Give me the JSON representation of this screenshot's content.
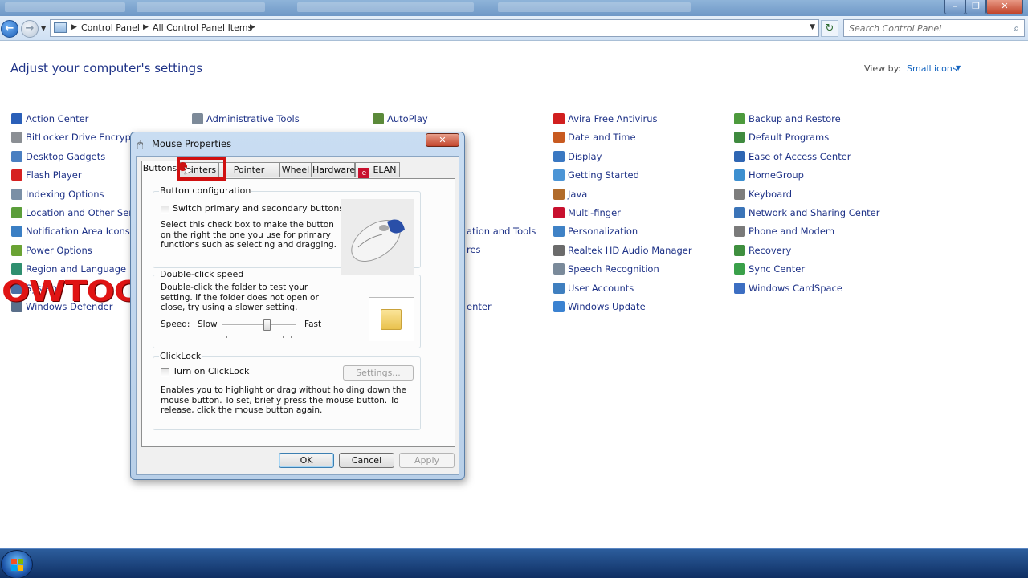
{
  "window": {
    "minimize_icon": "minimize-icon",
    "maximize_icon": "maximize-icon",
    "close_icon": "close-icon"
  },
  "address": {
    "breadcrumbs": [
      "Control Panel",
      "All Control Panel Items"
    ],
    "search_placeholder": "Search Control Panel"
  },
  "main": {
    "title": "Adjust your computer's settings",
    "view_by_label": "View by:",
    "view_by_value": "Small icons"
  },
  "columns": [
    {
      "items": [
        {
          "label": "Action Center",
          "color": "#2a5fb8"
        },
        {
          "label": "BitLocker Drive Encryption",
          "color": "#8b8f94"
        },
        {
          "label": "Desktop Gadgets",
          "color": "#4a7fc1"
        },
        {
          "label": "Flash Player",
          "color": "#d62020"
        },
        {
          "label": "Indexing Options",
          "color": "#7a8fa6"
        },
        {
          "label": "Location and Other Sensors",
          "color": "#5b9e3a"
        },
        {
          "label": "Notification Area Icons",
          "color": "#3b7fc4"
        },
        {
          "label": "Power Options",
          "color": "#6aa334"
        },
        {
          "label": "Region and Language",
          "color": "#2f8f6f"
        },
        {
          "label": "System",
          "color": "#4a6fa5"
        },
        {
          "label": "Windows Defender",
          "color": "#5a6f8a"
        }
      ]
    },
    {
      "items": [
        {
          "label": "Administrative Tools",
          "color": "#7d8a99"
        }
      ]
    },
    {
      "items": [
        {
          "label": "AutoPlay",
          "color": "#5b8a3a"
        }
      ]
    },
    {
      "items": [
        {
          "label": "Avira Free Antivirus",
          "color": "#d11f1f"
        },
        {
          "label": "Date and Time",
          "color": "#c85a20"
        },
        {
          "label": "Display",
          "color": "#3a78c2"
        },
        {
          "label": "Getting Started",
          "color": "#4c95d6"
        },
        {
          "label": "Java",
          "color": "#b06a2a"
        },
        {
          "label": "Multi-finger",
          "color": "#c8102e"
        },
        {
          "label": "Personalization",
          "color": "#3f82c6"
        },
        {
          "label": "Realtek HD Audio Manager",
          "color": "#6b6b6b"
        },
        {
          "label": "Speech Recognition",
          "color": "#7a8a9a"
        },
        {
          "label": "User Accounts",
          "color": "#3f7fbf"
        },
        {
          "label": "Windows Update",
          "color": "#3b82d1"
        }
      ]
    },
    {
      "items": [
        {
          "label": "Backup and Restore",
          "color": "#4d9a3d"
        },
        {
          "label": "Default Programs",
          "color": "#3f8a3f"
        },
        {
          "label": "Ease of Access Center",
          "color": "#2f66b3"
        },
        {
          "label": "HomeGroup",
          "color": "#3d8fd0"
        },
        {
          "label": "Keyboard",
          "color": "#7d7d7d"
        },
        {
          "label": "Network and Sharing Center",
          "color": "#3b74b8"
        },
        {
          "label": "Phone and Modem",
          "color": "#7a7a7a"
        },
        {
          "label": "Recovery",
          "color": "#3f8f3f"
        },
        {
          "label": "Sync Center",
          "color": "#3aa04a"
        },
        {
          "label": "Windows CardSpace",
          "color": "#3c6ec2"
        }
      ]
    }
  ],
  "partial_labels": [
    "ation and Tools",
    "res",
    "enter"
  ],
  "watermark": "OWTOCREATOR",
  "dialog": {
    "title": "Mouse Properties",
    "close_icon": "close-icon",
    "tabs": [
      {
        "label": "Buttons",
        "active": true
      },
      {
        "label": "Pointers",
        "active": false
      },
      {
        "label": "Pointer Options",
        "active": false
      },
      {
        "label": "Wheel",
        "active": false
      },
      {
        "label": "Hardware",
        "active": false
      },
      {
        "label": "ELAN",
        "active": false
      }
    ],
    "button_config": {
      "title": "Button configuration",
      "checkbox_label": "Switch primary and secondary buttons",
      "checked": false,
      "description": "Select this check box to make the button on the right the one you use for primary functions such as selecting and dragging."
    },
    "double_click": {
      "title": "Double-click speed",
      "description": "Double-click the folder to test your setting. If the folder does not open or close, try using a slower setting.",
      "speed_label": "Speed:",
      "slow_label": "Slow",
      "fast_label": "Fast",
      "speed_level": 0.6
    },
    "clicklock": {
      "title": "ClickLock",
      "checkbox_label": "Turn on ClickLock",
      "checked": false,
      "settings_button": "Settings...",
      "description": "Enables you to highlight or drag without holding down the mouse button. To set, briefly press the mouse button. To release, click the mouse button again."
    },
    "buttons": {
      "ok": "OK",
      "cancel": "Cancel",
      "apply": "Apply"
    }
  },
  "taskbar": {
    "start_icon": "windows-logo-icon"
  }
}
